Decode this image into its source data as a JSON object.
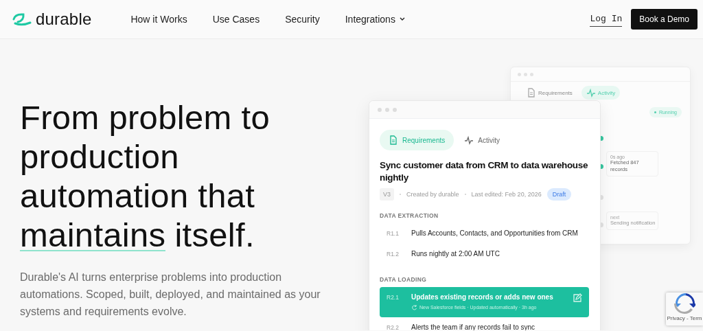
{
  "nav": {
    "logo": "durable",
    "links": [
      {
        "label": "How it Works",
        "dropdown": false
      },
      {
        "label": "Use Cases",
        "dropdown": false
      },
      {
        "label": "Security",
        "dropdown": false
      },
      {
        "label": "Integrations",
        "dropdown": true
      }
    ],
    "login": "Log In",
    "cta": "Book a Demo"
  },
  "hero": {
    "heading_lines": [
      "From problem to",
      "production",
      "automation that"
    ],
    "highlight": "maintains",
    "tail": "itself.",
    "subtitle": "Durable's AI turns enterprise problems into production automations. Scoped, built, deployed, and maintained as your systems and requirements evolve."
  },
  "back_window": {
    "tabs": [
      {
        "label": "Requirements",
        "kind": "doc",
        "selected": false
      },
      {
        "label": "Activity",
        "kind": "pulse",
        "selected": true
      }
    ],
    "status": "Running",
    "events": [
      {
        "time": "0s ago",
        "text": "Fetched 847 records",
        "done": true
      },
      {
        "time": "next",
        "text": "Sending notification",
        "done": false
      }
    ]
  },
  "front_window": {
    "tabs": [
      {
        "label": "Requirements",
        "kind": "doc",
        "selected": true
      },
      {
        "label": "Activity",
        "kind": "pulse",
        "selected": false
      }
    ],
    "title": "Sync customer data from CRM to data warehouse nightly",
    "version": "V3",
    "created": "Created by durable",
    "edited": "Last edited: Feb 20, 2026",
    "status": "Draft",
    "sections": [
      {
        "title": "DATA EXTRACTION",
        "items": [
          {
            "id": "R1.1",
            "text": "Pulls Accounts, Contacts, and Opportunities from CRM",
            "selected": false
          },
          {
            "id": "R1.2",
            "text": "Runs nightly at 2:00 AM UTC",
            "selected": false
          }
        ]
      },
      {
        "title": "DATA LOADING",
        "items": [
          {
            "id": "R2.1",
            "text": "Updates existing records or adds new ones",
            "selected": true,
            "note": "New Salesforce fields · Updated automatically · 3h ago"
          },
          {
            "id": "R2.2",
            "text": "Alerts the team if any records fail to sync",
            "selected": false
          }
        ]
      }
    ]
  },
  "recaptcha": {
    "links": "Privacy - Term"
  }
}
